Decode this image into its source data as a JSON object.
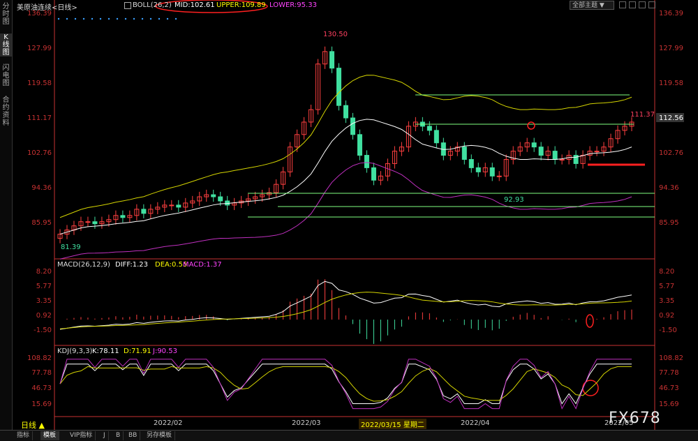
{
  "sidebar": [
    {
      "label": "分时图",
      "active": false
    },
    {
      "label": "K线图",
      "active": true
    },
    {
      "label": "闪电图",
      "active": false
    },
    {
      "label": "合约资料",
      "active": false
    }
  ],
  "header": {
    "instrument": "美原油连续",
    "period": "日线",
    "boll_label": "BOLL(26,2)",
    "mid_label": "MID:102.61",
    "upper_label": "UPPER:109.89",
    "lower_label": "LOWER:95.33",
    "theme": "全部主题"
  },
  "main_axis": {
    "labels": [
      "136.39",
      "127.99",
      "119.58",
      "111.17",
      "102.76",
      "94.36",
      "85.95"
    ],
    "right_extra": "112.56"
  },
  "annotations": {
    "high": "130.50",
    "recent_high": "111.37",
    "low_mid": "92.93",
    "low_start": "81.39"
  },
  "macd": {
    "title": "MACD(26,12,9)",
    "diff": "DIFF:1.23",
    "dea": "DEA:0.55",
    "macd": "MACD:1.37",
    "labels": [
      "8.20",
      "5.77",
      "3.35",
      "0.92",
      "-1.50"
    ]
  },
  "kdj": {
    "title": "KDJ(9,3,3)",
    "k": "K:78.11",
    "d": "D:71.91",
    "j": "J:90.53",
    "labels": [
      "108.82",
      "77.78",
      "46.73",
      "15.69"
    ]
  },
  "dates": {
    "feb": "2022/02",
    "mar": "2022/03",
    "cursor": "2022/03/15 星期二",
    "apr": "2022/04",
    "may": "2022/05",
    "period_tab": "日线 ▲"
  },
  "bottom_tabs": [
    "指标",
    "模板",
    "VIP指标",
    "J",
    "B",
    "BB",
    "另存模板"
  ],
  "watermark": "FX678",
  "colors": {
    "up": "#ff4040",
    "down": "#40e0a0",
    "boll_upper": "#d4d400",
    "boll_mid": "#ffffff",
    "boll_lower": "#c030c0",
    "mid_txt": "#ffffff",
    "upper_txt": "#ffff00",
    "lower_txt": "#ff40ff",
    "axis": "#c83232",
    "line": "#80ff80"
  },
  "chart_data": {
    "type": "candlestick",
    "closes": [
      83,
      84,
      85,
      86,
      86,
      85.5,
      86,
      86.5,
      87.5,
      87,
      87.5,
      89,
      88,
      89,
      89.5,
      90,
      90,
      89.5,
      90.5,
      91,
      92,
      92.5,
      92,
      91,
      90,
      90.5,
      91,
      91.5,
      92,
      92.5,
      93,
      95,
      98,
      104,
      107,
      110,
      113,
      124,
      127,
      123,
      114,
      111,
      107,
      102,
      99,
      96,
      97,
      100,
      103,
      104,
      109,
      110,
      109,
      108,
      105,
      102,
      103,
      104,
      101,
      99,
      98,
      99,
      97,
      97,
      101,
      103,
      104,
      105,
      104,
      102,
      103,
      101,
      101,
      102,
      100,
      102,
      103,
      103,
      104,
      106,
      108,
      109,
      110
    ]
  }
}
